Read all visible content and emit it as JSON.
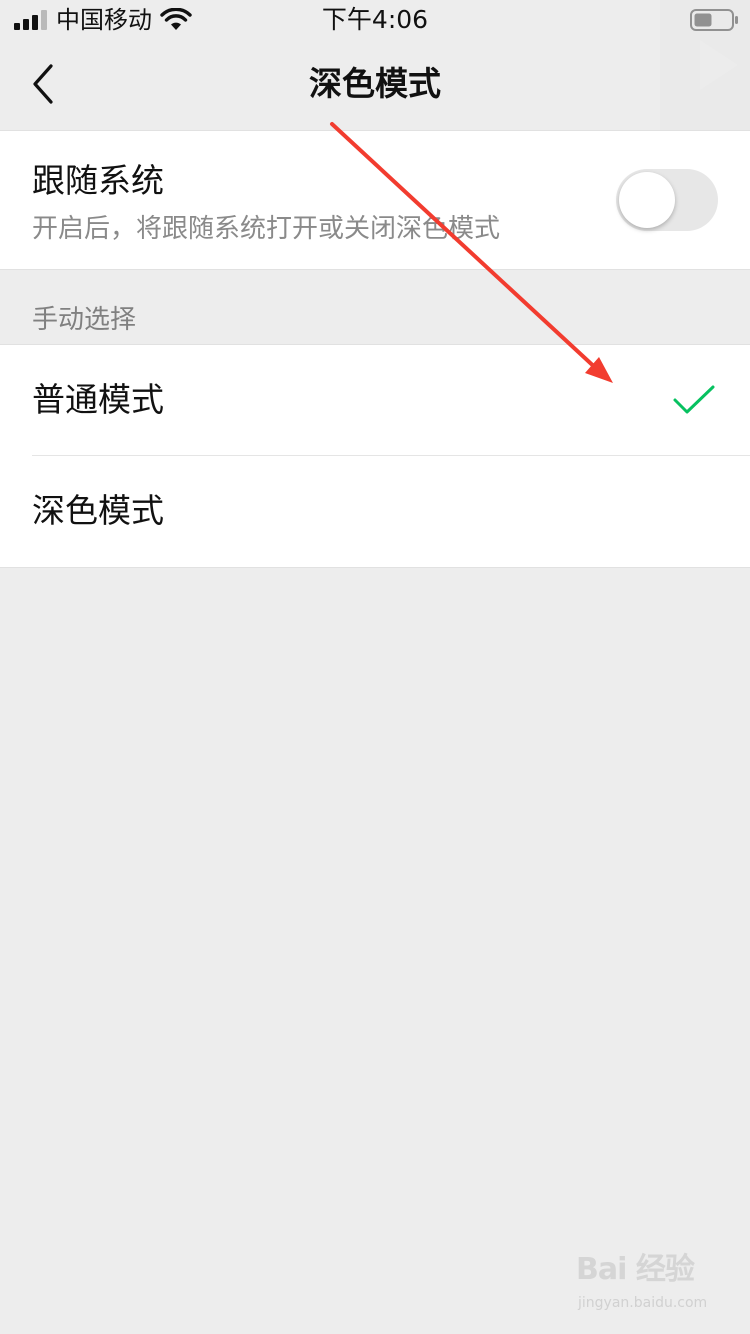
{
  "status_bar": {
    "carrier": "中国移动",
    "time": "下午4:06",
    "icons": [
      "signal-icon",
      "wifi-icon",
      "battery-icon"
    ]
  },
  "nav": {
    "title": "深色模式",
    "back_icon": "chevron-left-icon"
  },
  "follow_system": {
    "title": "跟随系统",
    "description": "开启后，将跟随系统打开或关闭深色模式",
    "toggle_on": false
  },
  "manual": {
    "section_label": "手动选择",
    "options": [
      {
        "label": "普通模式",
        "selected": true
      },
      {
        "label": "深色模式",
        "selected": false
      }
    ]
  },
  "colors": {
    "background": "#ededed",
    "card": "#ffffff",
    "check": "#07c160",
    "annotation_arrow": "#f23c2f"
  },
  "watermark": {
    "logo": "Bai 经验",
    "url": "jingyan.baidu.com"
  }
}
